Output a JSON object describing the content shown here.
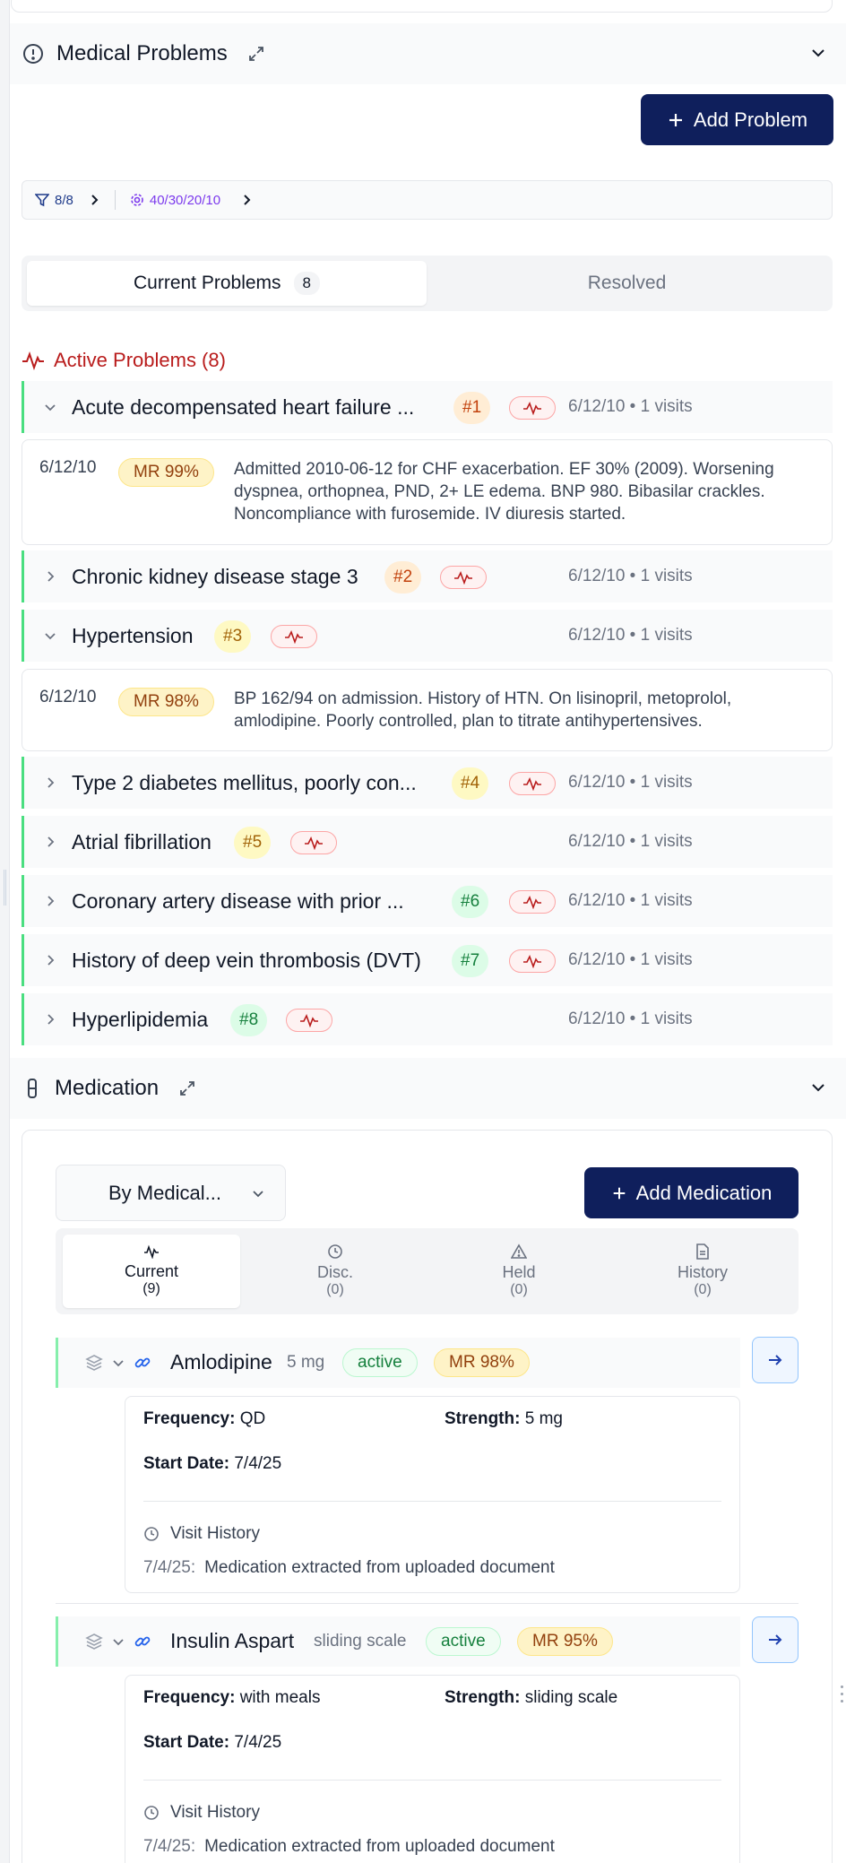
{
  "problems_section": {
    "title": "Medical Problems",
    "add_button": "Add Problem",
    "filter_count": "8/8",
    "filter_weights": "40/30/20/10",
    "tabs": {
      "current_label": "Current Problems",
      "current_count": "8",
      "resolved_label": "Resolved"
    },
    "active_heading": "Active Problems (8)",
    "items": [
      {
        "name": "Acute decompensated heart failure ...",
        "rank": "#1",
        "meta": "6/12/10 • 1 visits"
      },
      {
        "name": "Chronic kidney disease stage 3",
        "rank": "#2",
        "meta": "6/12/10 • 1 visits"
      },
      {
        "name": "Hypertension",
        "rank": "#3",
        "meta": "6/12/10 • 1 visits"
      },
      {
        "name": "Type 2 diabetes mellitus, poorly con...",
        "rank": "#4",
        "meta": "6/12/10 • 1 visits"
      },
      {
        "name": "Atrial fibrillation",
        "rank": "#5",
        "meta": "6/12/10 • 1 visits"
      },
      {
        "name": "Coronary artery disease with prior ...",
        "rank": "#6",
        "meta": "6/12/10 • 1 visits"
      },
      {
        "name": "History of deep vein thrombosis (DVT)",
        "rank": "#7",
        "meta": "6/12/10 • 1 visits"
      },
      {
        "name": "Hyperlipidemia",
        "rank": "#8",
        "meta": "6/12/10 • 1 visits"
      }
    ],
    "details": [
      {
        "date": "6/12/10",
        "mr": "MR 99%",
        "text": "Admitted 2010-06-12 for CHF exacerbation. EF 30% (2009). Worsening dyspnea, orthopnea, PND, 2+ LE edema. BNP 980. Bibasilar crackles. Noncompliance with furosemide. IV diuresis started."
      },
      {
        "date": "6/12/10",
        "mr": "MR 98%",
        "text": "BP 162/94 on admission. History of HTN. On lisinopril, metoprolol, amlodipine. Poorly controlled, plan to titrate antihypertensives."
      }
    ]
  },
  "medication_section": {
    "title": "Medication",
    "group_by": "By Medical...",
    "add_button": "Add Medication",
    "tabs": [
      {
        "label": "Current",
        "count": "(9)"
      },
      {
        "label": "Disc.",
        "count": "(0)"
      },
      {
        "label": "Held",
        "count": "(0)"
      },
      {
        "label": "History",
        "count": "(0)"
      }
    ],
    "meds": [
      {
        "name": "Amlodipine",
        "dose": "5 mg",
        "status": "active",
        "mr": "MR 98%",
        "frequency_label": "Frequency:",
        "frequency": "QD",
        "strength_label": "Strength:",
        "strength": "5 mg",
        "start_label": "Start Date:",
        "start": "7/4/25",
        "history_title": "Visit History",
        "history_date": "7/4/25:",
        "history_text": "Medication extracted from uploaded document"
      },
      {
        "name": "Insulin Aspart",
        "dose": "sliding scale",
        "status": "active",
        "mr": "MR 95%",
        "frequency_label": "Frequency:",
        "frequency": "with meals",
        "strength_label": "Strength:",
        "strength": "sliding scale",
        "start_label": "Start Date:",
        "start": "7/4/25",
        "history_title": "Visit History",
        "history_date": "7/4/25:",
        "history_text": "Medication extracted from uploaded document"
      }
    ]
  },
  "colors": {
    "primary": "#0f1f5c",
    "active_border": "#4ade80",
    "alert_red": "#b91c1c",
    "filter_purple": "#7c3aed"
  }
}
